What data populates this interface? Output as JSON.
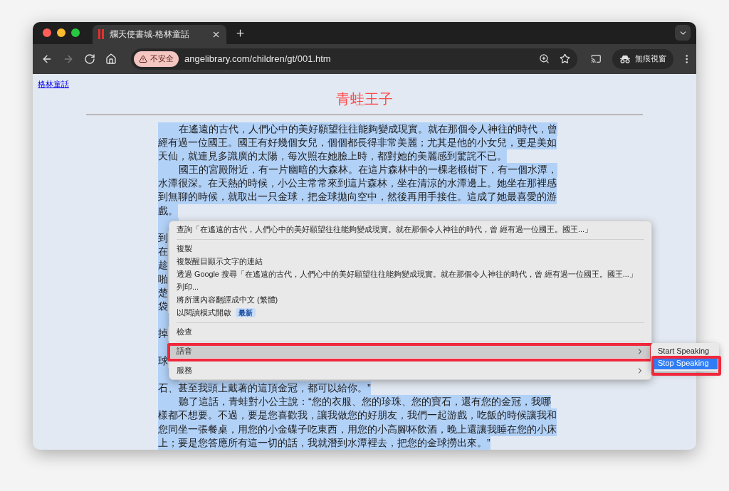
{
  "window": {
    "controls": [
      {
        "color": "#ff5f57"
      },
      {
        "color": "#febc2e"
      },
      {
        "color": "#28c840"
      }
    ]
  },
  "tabs": [
    {
      "title": "爛天使書城-格林童話",
      "selected": true
    }
  ],
  "nav_buttons": [
    {
      "kind": "back",
      "disabled": false
    },
    {
      "kind": "forward",
      "disabled": true
    },
    {
      "kind": "reload",
      "disabled": false
    },
    {
      "kind": "home",
      "disabled": false
    }
  ],
  "address_bar": {
    "security_label": "不安全",
    "url": "angelibrary.com/children/gt/001.htm"
  },
  "profile": {
    "label": "無痕視窗"
  },
  "page": {
    "breadcrumb_link": "格林童話",
    "title": "青蛙王子",
    "lines": [
      {
        "text": "在遙遠的古代，人們心中的美好願望往往能夠變成現實。就在那個令人神往的時代，曾",
        "indent": true,
        "selected": true
      },
      {
        "text": "經有過一位國王。國王有好幾個女兒，個個都長得非常美麗；尤其是他的小女兒，更是美如",
        "indent": false,
        "selected": true
      },
      {
        "text": "天仙，就連見多識廣的太陽，每次照在她臉上時，都對她的美麗感到驚詫不已。",
        "indent": false,
        "selected": true
      },
      {
        "text": "國王的宮殿附近，有一片幽暗的大森林。在這片森林中的一棵老椴樹下，有一個水潭，",
        "indent": true,
        "selected": true
      },
      {
        "text": "水潭很深。在天熱的時候，小公主常常來到這片森林，坐在清涼的水潭邊上。她坐在那裡感",
        "indent": false,
        "selected": true
      },
      {
        "text": "到無聊的時候，就取出一只金球，把金球拋向空中，然後再用手接住。這成了她最喜愛的游",
        "indent": false,
        "selected": true
      },
      {
        "text": "戲。",
        "indent": false,
        "selected": true
      },
      {
        "indent": true,
        "selected": true
      },
      {
        "text": "到",
        "indent": false,
        "selected": true
      },
      {
        "text": "在",
        "indent": false,
        "selected": true
      },
      {
        "text": "趁",
        "indent": false,
        "selected": true
      },
      {
        "text": "啪",
        "indent": false,
        "selected": true
      },
      {
        "text": "楚",
        "indent": false,
        "selected": true
      },
      {
        "text": "袋",
        "indent": false,
        "selected": true
      },
      {
        "indent": true,
        "selected": true
      },
      {
        "text": "掉",
        "indent": false,
        "selected": true
      },
      {
        "indent": true,
        "selected": true
      },
      {
        "text": "球",
        "indent": false,
        "selected": true
      },
      {
        "indent": true,
        "selected": true
      },
      {
        "text": "石、甚至我頭上戴著的這頂金冠，都可以給你。”",
        "indent": false,
        "selected": true
      },
      {
        "text": "聽了這話，青蛙對小公主說：“您的衣服、您的珍珠、您的寶石，還有您的金冠，我哪",
        "indent": true,
        "selected": true
      },
      {
        "text": "樣都不想要。不過，要是您喜歡我，讓我做您的好朋友，我們一起游戲，吃飯的時候讓我和",
        "indent": false,
        "selected": true
      },
      {
        "text": "您同坐一張餐桌，用您的小金碟子吃東西，用您的小高腳杯飲酒，晚上還讓我睡在您的小床",
        "indent": false,
        "selected": true
      },
      {
        "text": "上；要是您答應所有這一切的話，我就潛到水潭裡去，把您的金球撈出來。”",
        "indent": false,
        "selected": true
      }
    ]
  },
  "context_menu": {
    "items": [
      {
        "kind": "item",
        "label": "查詢「在遙遠的古代，人們心中的美好願望往往能夠變成現實。就在那個令人神往的時代，曾 經有過一位國王。國王...」",
        "selected": false
      },
      {
        "kind": "separator"
      },
      {
        "kind": "item",
        "label": "複製",
        "selected": false
      },
      {
        "kind": "item",
        "label": "複製醒目顯示文字的連結",
        "selected": false
      },
      {
        "kind": "item",
        "label": "透過 Google 搜尋「在遙遠的古代，人們心中的美好願望往往能夠變成現實。就在那個令人神往的時代，曾 經有過一位國王。國王...」",
        "selected": false
      },
      {
        "kind": "item",
        "label": "列印...",
        "selected": false
      },
      {
        "kind": "item",
        "label": "將所選內容翻譯成中文 (繁體)",
        "selected": false
      },
      {
        "kind": "item",
        "label": "以閱讀模式開啟",
        "badge": "最新",
        "selected": false
      },
      {
        "kind": "separator"
      },
      {
        "kind": "item",
        "label": "檢查",
        "selected": false
      },
      {
        "kind": "separator"
      },
      {
        "kind": "submenu",
        "label": "語音",
        "selected": true
      },
      {
        "kind": "separator"
      },
      {
        "kind": "submenu",
        "label": "服務",
        "selected": false
      }
    ]
  },
  "submenu": {
    "items": [
      {
        "label": "Start Speaking",
        "selected": false
      },
      {
        "label": "Stop Speaking",
        "selected": true
      }
    ]
  }
}
